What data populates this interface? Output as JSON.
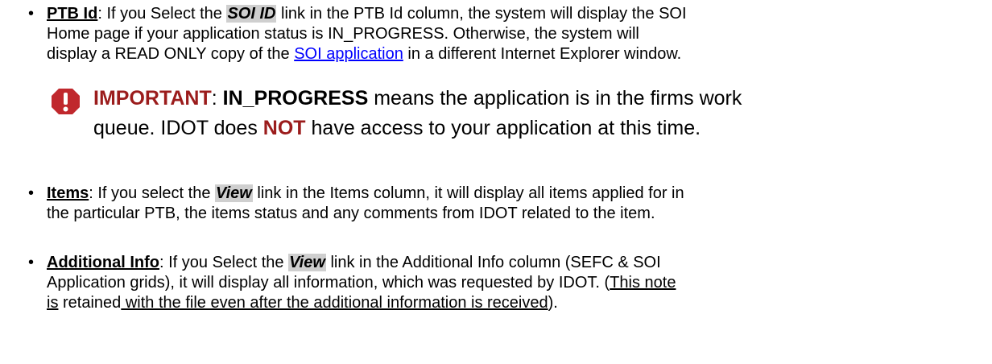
{
  "items": [
    {
      "term": "PTB Id",
      "lines": [
        {
          "pre": ": If you Select the ",
          "hl": "SOI ID",
          "post": " link in the PTB Id column, the system will display the SOI"
        },
        {
          "text": "Home page if your application status is IN_PROGRESS.  Otherwise, the system will"
        },
        {
          "pre": "display a READ ONLY copy of the ",
          "link": "SOI application",
          "post": " in a different Internet Explorer window."
        }
      ]
    },
    {
      "term": "Items",
      "lines": [
        {
          "pre": ": If you select the ",
          "hl": "View",
          "post": " link in the Items column, it will display all items applied for in"
        },
        {
          "text": "the particular PTB, the items status and any comments from IDOT related to the item."
        }
      ]
    },
    {
      "term": "Additional Info",
      "lines": [
        {
          "pre": ": If you Select the ",
          "hl": "View",
          "post": " link in the Additional Info column (SEFC & SOI"
        },
        {
          "pre": "Application grids), it will display all information, which was requested by IDOT. (",
          "ul": "This note"
        },
        {
          "ul1": "is",
          "mid": " retained",
          "ul2": " with the file even after the additional information is received",
          "tail": ")."
        }
      ]
    }
  ],
  "important": {
    "label": "IMPORTANT",
    "colon": ": ",
    "term": "IN_PROGRESS",
    "line1_rest": " means the application is in the firms work",
    "line2_pre": "queue.  IDOT does ",
    "not_word": "NOT",
    "line2_post": " have access to your application at this time.",
    "icon": "warning-octagon-icon",
    "icon_color": "#c0282d"
  },
  "bullet_char": "•"
}
